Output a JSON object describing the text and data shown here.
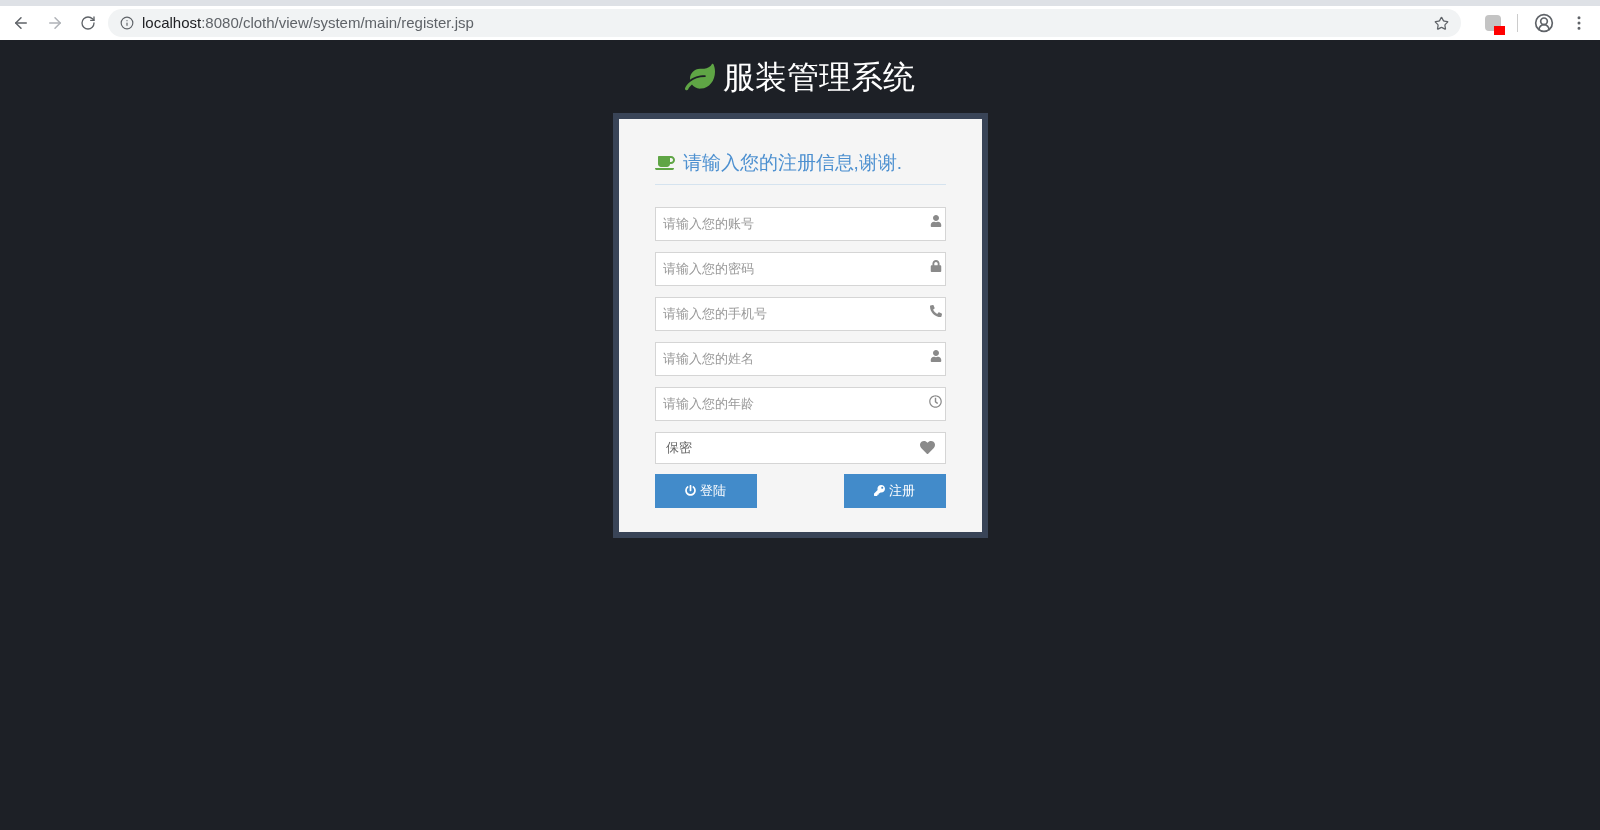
{
  "browser": {
    "url_host": "localhost",
    "url_rest": ":8080/cloth/view/system/main/register.jsp"
  },
  "app_title": "服装管理系统",
  "form": {
    "heading": "请输入您的注册信息,谢谢.",
    "fields": [
      {
        "kind": "account",
        "placeholder": "请输入您的账号"
      },
      {
        "kind": "password",
        "placeholder": "请输入您的密码"
      },
      {
        "kind": "phone",
        "placeholder": "请输入您的手机号"
      },
      {
        "kind": "name",
        "placeholder": "请输入您的姓名"
      },
      {
        "kind": "age",
        "placeholder": "请输入您的年龄"
      },
      {
        "kind": "gender",
        "value": "保密"
      }
    ],
    "buttons": [
      {
        "kind": "login",
        "label": "登陆"
      },
      {
        "kind": "register",
        "label": "注册"
      }
    ]
  }
}
